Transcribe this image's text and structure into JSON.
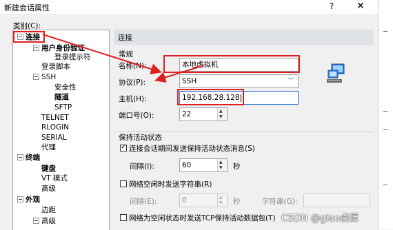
{
  "window": {
    "title": "新建会话属性",
    "help": "?",
    "close": "✕"
  },
  "category": {
    "label": "类别(C):",
    "tree": [
      {
        "label": "连接",
        "bold": true,
        "box": true
      },
      {
        "label": "用户身份验证",
        "bold": true,
        "box": true
      },
      {
        "label": "登录提示符",
        "bold": false,
        "box": false
      },
      {
        "label": "登录脚本",
        "bold": false,
        "box": false
      },
      {
        "label": "SSH",
        "bold": false,
        "box": true
      },
      {
        "label": "安全性",
        "bold": false,
        "box": false
      },
      {
        "label": "隧道",
        "bold": true,
        "box": false
      },
      {
        "label": "SFTP",
        "bold": false,
        "box": false
      },
      {
        "label": "TELNET",
        "bold": false,
        "box": false
      },
      {
        "label": "RLOGIN",
        "bold": false,
        "box": false
      },
      {
        "label": "SERIAL",
        "bold": false,
        "box": false
      },
      {
        "label": "代理",
        "bold": false,
        "box": false
      },
      {
        "label": "终端",
        "bold": true,
        "box": true
      },
      {
        "label": "键盘",
        "bold": true,
        "box": false
      },
      {
        "label": "VT 模式",
        "bold": false,
        "box": false
      },
      {
        "label": "高级",
        "bold": false,
        "box": false
      },
      {
        "label": "外观",
        "bold": true,
        "box": true
      },
      {
        "label": "边距",
        "bold": false,
        "box": false
      },
      {
        "label": "高级",
        "bold": false,
        "box": false
      }
    ]
  },
  "panel": {
    "header": "连接",
    "general": {
      "group_label": "常规",
      "name_label": "名称(N):",
      "name_value": "本地虚拟机",
      "protocol_label": "协议(P):",
      "protocol_value": "SSH",
      "host_label": "主机(H):",
      "host_value": "192.168.28.128",
      "port_label": "端口号(O):",
      "port_value": "22"
    },
    "keepalive": {
      "group_label": "保持活动状态",
      "send_msg_label": "连接会话期间发送保持活动状态消息(S)",
      "send_msg_checked": true,
      "interval_label": "间隔(I):",
      "interval_value": "60",
      "seconds1": "秒",
      "idle_string_label": "网络空闲时发送字符串(R)",
      "idle_string_checked": false,
      "interval2_label": "间隔(E):",
      "interval2_value": "0",
      "seconds2": "秒",
      "string_label": "字符串(G):",
      "tcp_label": "网络为空闲状态时发送TCP保持活动数据包(T)",
      "tcp_checked": false
    }
  },
  "watermark": "CSDN @giao卤蛋"
}
